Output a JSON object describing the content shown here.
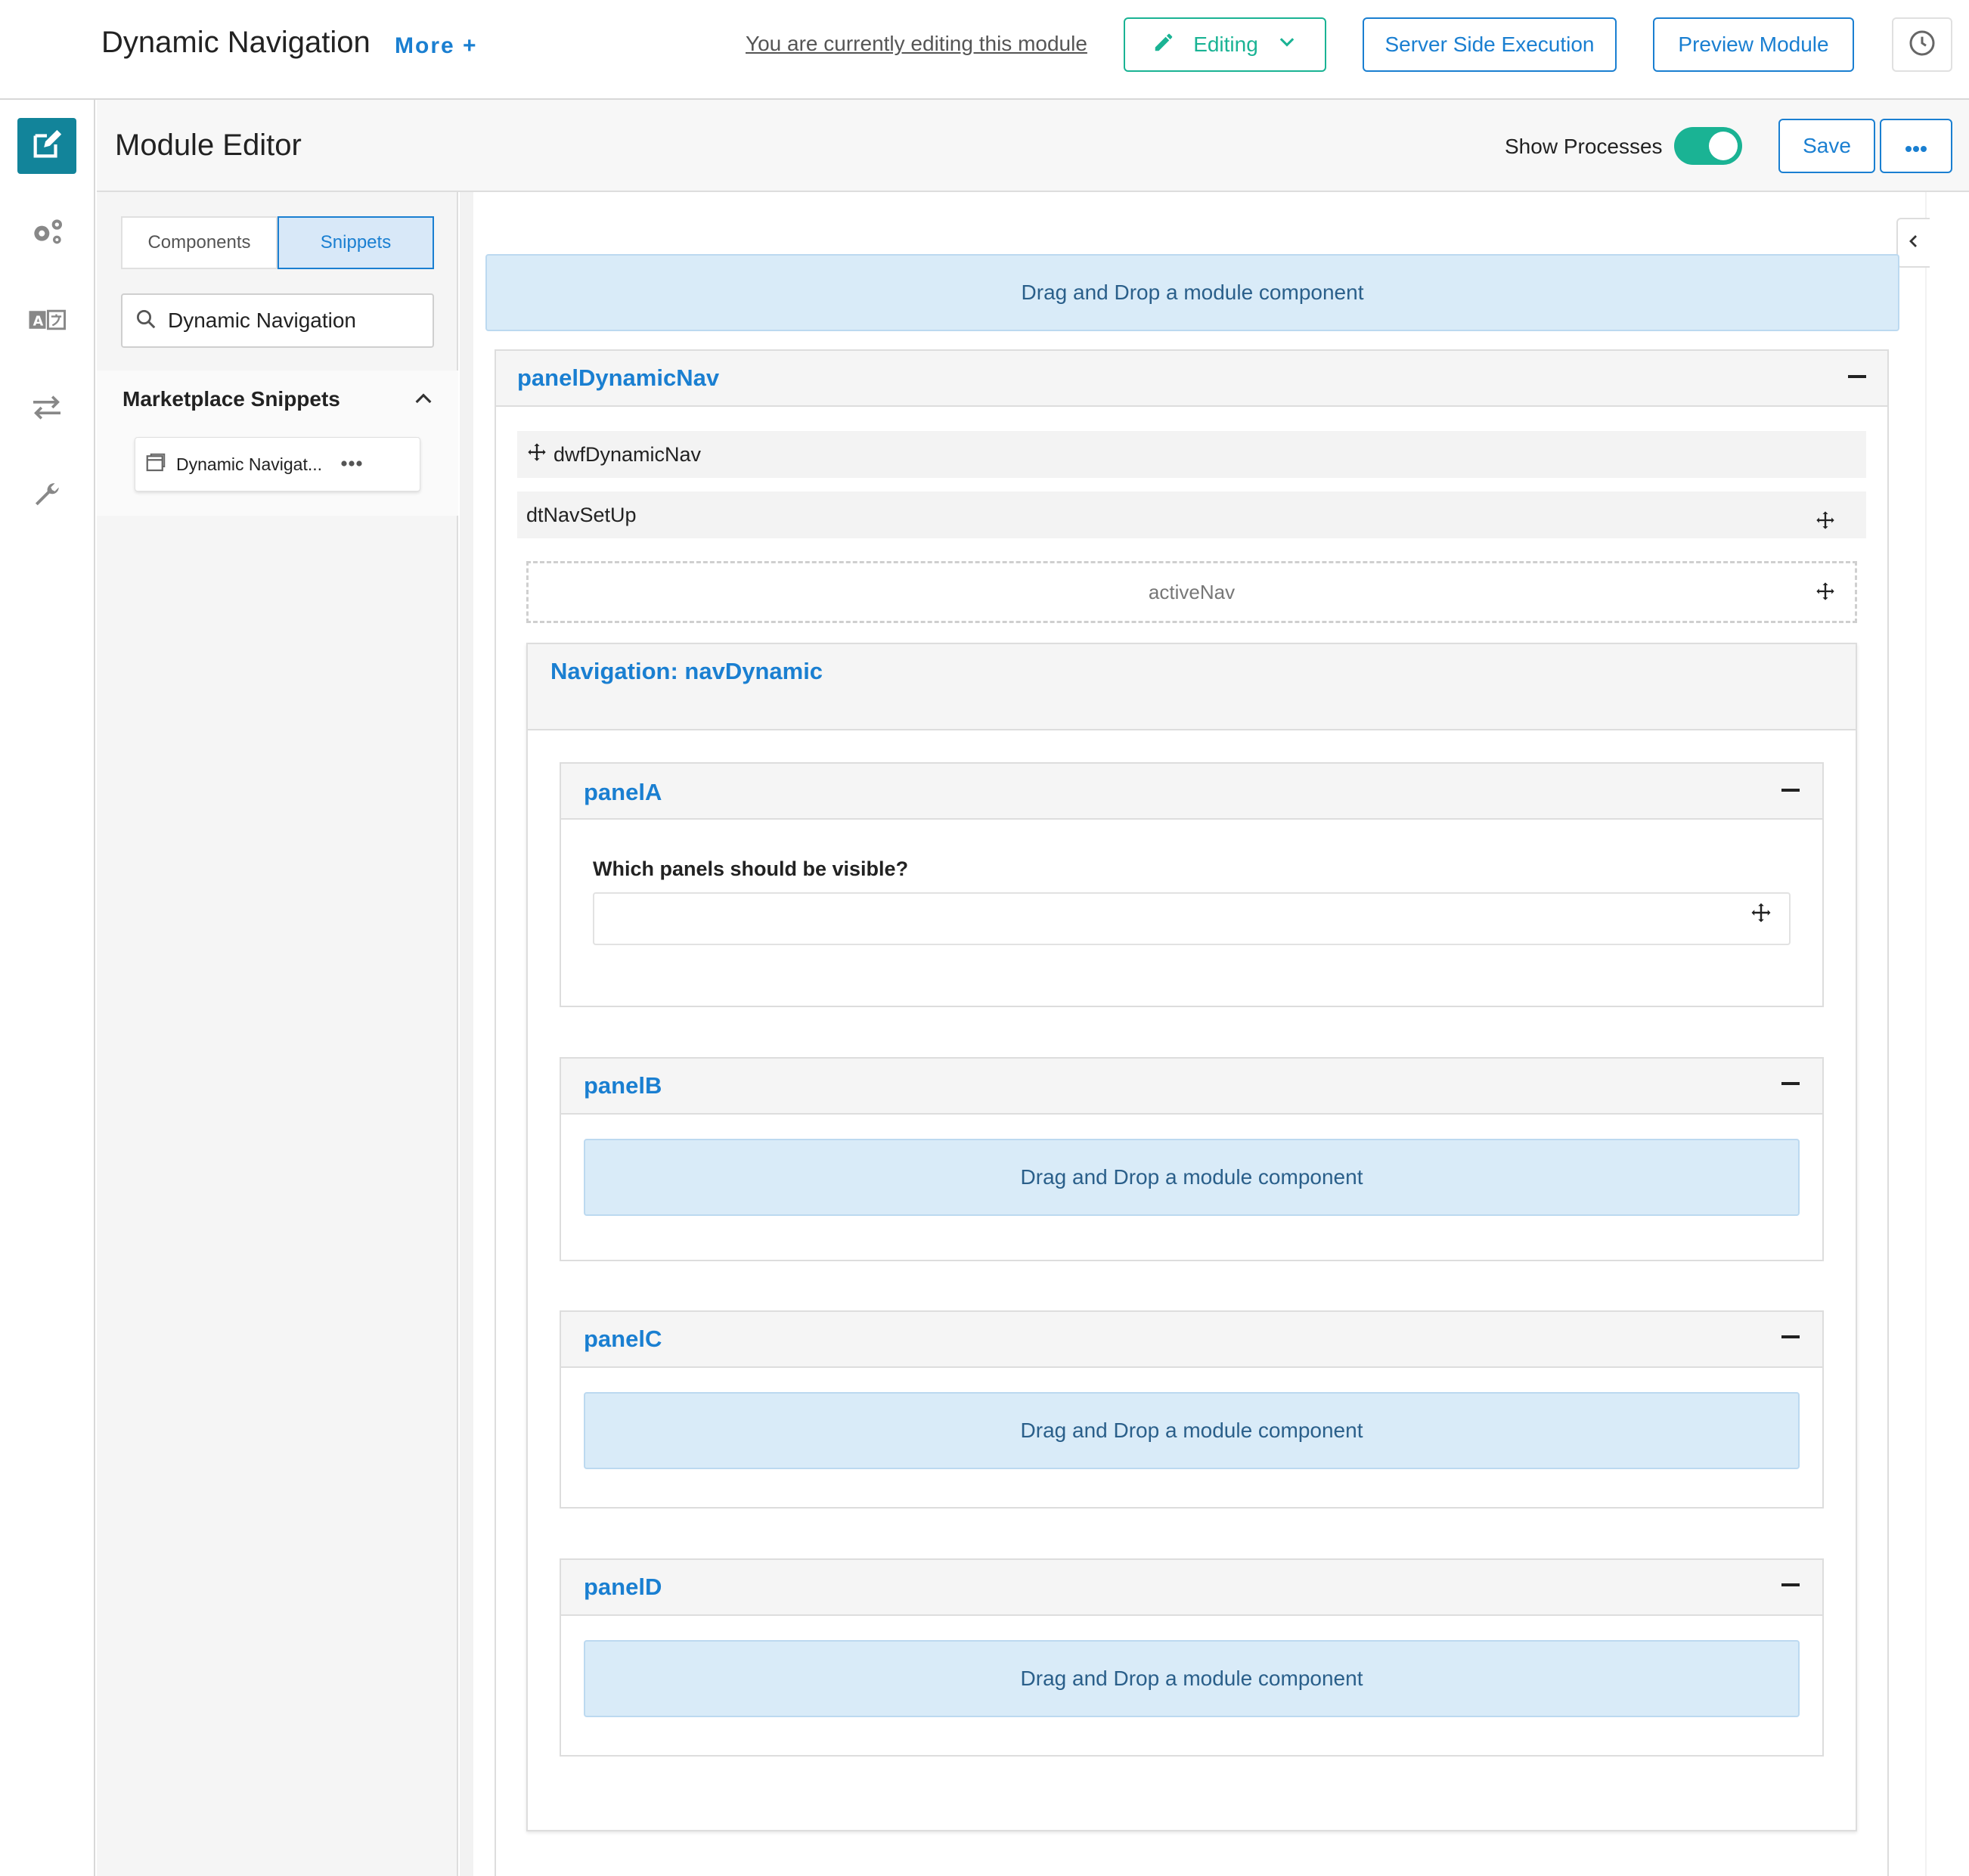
{
  "topbar": {
    "title": "Dynamic Navigation",
    "more": "More +",
    "editing_note": "You are currently editing this module",
    "editing_label": "Editing",
    "server_label": "Server Side Execution",
    "preview_label": "Preview Module"
  },
  "header": {
    "title": "Module Editor",
    "show_processes": "Show Processes",
    "show_processes_on": true,
    "save": "Save"
  },
  "sidebar": {
    "tabs": [
      {
        "label": "Components",
        "active": false
      },
      {
        "label": "Snippets",
        "active": true
      }
    ],
    "search_value": "Dynamic Navigation",
    "section_title": "Marketplace Snippets",
    "snippet_label": "Dynamic Navigat..."
  },
  "canvas": {
    "dropzone_text": "Drag and Drop a module component",
    "outer_panel": "panelDynamicNav",
    "dwf": "dwfDynamicNav",
    "dt": "dtNavSetUp",
    "active_nav": "activeNav",
    "nav_title": "Navigation: navDynamic",
    "panels": [
      {
        "name": "panelA",
        "question": "Which panels should be visible?"
      },
      {
        "name": "panelB"
      },
      {
        "name": "panelC"
      },
      {
        "name": "panelD"
      }
    ]
  },
  "colors": {
    "accent": "#1a7fd1",
    "success": "#1ab394",
    "rail_active": "#12849a",
    "dropzone": "#d9ebf8"
  }
}
